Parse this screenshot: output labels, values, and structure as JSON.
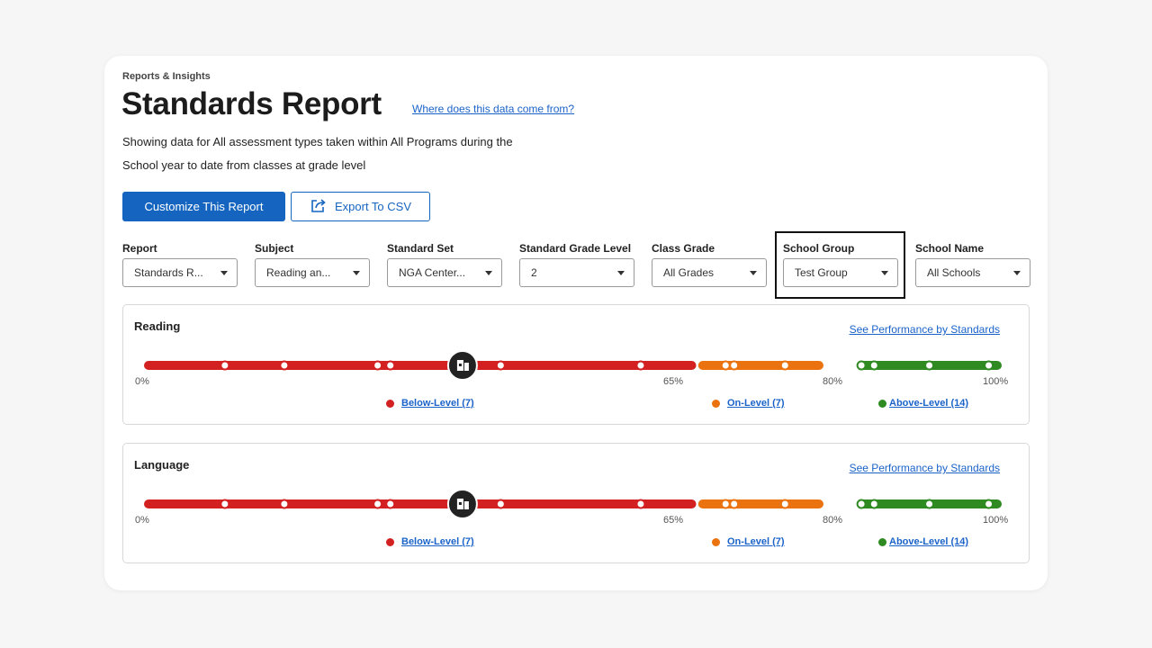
{
  "header": {
    "breadcrumb": "Reports & Insights",
    "title": "Standards Report",
    "help_link": "Where does this data come from?",
    "description_line1": "Showing data for All assessment types taken within All Programs during the",
    "description_line2": "School year to date from classes at grade level"
  },
  "actions": {
    "customize": "Customize This Report",
    "export": "Export To CSV"
  },
  "filters": [
    {
      "label": "Report",
      "value": "Standards R..."
    },
    {
      "label": "Subject",
      "value": "Reading an..."
    },
    {
      "label": "Standard Set",
      "value": "NGA Center..."
    },
    {
      "label": "Standard Grade Level",
      "value": "2"
    },
    {
      "label": "Class Grade",
      "value": "All Grades"
    },
    {
      "label": "School Group",
      "value": "Test Group"
    },
    {
      "label": "School Name",
      "value": "All Schools"
    }
  ],
  "colors": {
    "below": "#d32121",
    "on": "#ea7310",
    "above": "#2f8a22",
    "primary": "#1565c0",
    "link": "#1b63c9"
  },
  "panels": [
    {
      "title": "Reading",
      "link": "See Performance by Standards",
      "ticks": [
        "0%",
        "65%",
        "80%",
        "100%"
      ],
      "legend": [
        {
          "label": "Below-Level (7)"
        },
        {
          "label": "On-Level (7)"
        },
        {
          "label": "Above-Level (14)"
        }
      ],
      "marker_score_pct": 37,
      "scores_pct": [
        9,
        16,
        27,
        28.5,
        36,
        41.5,
        58,
        68,
        69,
        75,
        84,
        85.5,
        92,
        99
      ]
    },
    {
      "title": "Language",
      "link": "See Performance by Standards",
      "ticks": [
        "0%",
        "65%",
        "80%",
        "100%"
      ],
      "legend": [
        {
          "label": "Below-Level (7)"
        },
        {
          "label": "On-Level (7)"
        },
        {
          "label": "Above-Level (14)"
        }
      ],
      "marker_score_pct": 37,
      "scores_pct": [
        9,
        16,
        27,
        28.5,
        36,
        41.5,
        58,
        68,
        69,
        75,
        84,
        85.5,
        92,
        99
      ]
    }
  ]
}
